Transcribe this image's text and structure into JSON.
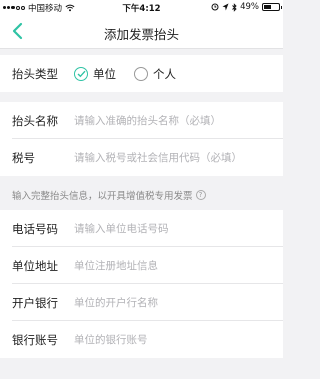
{
  "status_bar": {
    "carrier": "中国移动",
    "time": "下午4:12",
    "battery": "49%",
    "battery_level": 0.49
  },
  "header": {
    "title": "添加发票抬头"
  },
  "type_section": {
    "label": "抬头类型",
    "options": [
      {
        "label": "单位",
        "selected": true
      },
      {
        "label": "个人",
        "selected": false
      }
    ]
  },
  "required_fields": [
    {
      "label": "抬头名称",
      "placeholder": "请输入准确的抬头名称（必填）"
    },
    {
      "label": "税号",
      "placeholder": "请输入税号或社会信用代码（必填）"
    }
  ],
  "hint": {
    "text": "输入完整抬头信息，以开具增值税专用发票",
    "icon": "?"
  },
  "optional_fields": [
    {
      "label": "电话号码",
      "placeholder": "请输入单位电话号码"
    },
    {
      "label": "单位地址",
      "placeholder": "单位注册地址信息"
    },
    {
      "label": "开户银行",
      "placeholder": "单位的开户行名称"
    },
    {
      "label": "银行账号",
      "placeholder": "单位的银行账号"
    }
  ],
  "colors": {
    "accent": "#2fc3a4",
    "background": "#f2f2f4"
  },
  "icons": [
    "signal-icon",
    "wifi-icon",
    "back-arrow-icon",
    "location-icon",
    "alarm-icon",
    "bluetooth-icon",
    "battery-icon",
    "checkmark-icon",
    "help-icon"
  ]
}
